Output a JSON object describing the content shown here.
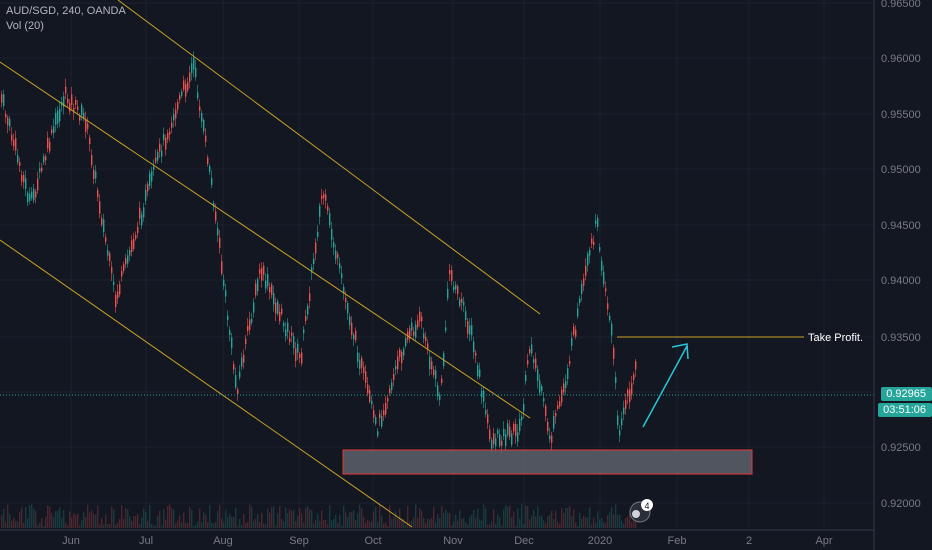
{
  "header": {
    "symbol": "AUD/SGD, 240, OANDA",
    "volume": "Vol (20)"
  },
  "y_axis": {
    "ticks": [
      "0.96500",
      "0.96000",
      "0.95500",
      "0.95000",
      "0.94500",
      "0.94000",
      "0.93500",
      "0.93000",
      "0.92500",
      "0.92000"
    ]
  },
  "x_axis": {
    "ticks": [
      "Jun",
      "Jul",
      "Aug",
      "Sep",
      "Oct",
      "Nov",
      "Dec",
      "2020",
      "Feb",
      "2",
      "Apr"
    ]
  },
  "current": {
    "price": "0.92965",
    "countdown": "03:51:06"
  },
  "annotation": {
    "take_profit": "Take Profit."
  },
  "event_badge": {
    "count": "4"
  },
  "colors": {
    "up": "#26a69a",
    "down": "#ef5350",
    "channel": "#c9a227",
    "zone": "#5d606b",
    "zone_border": "#e53935",
    "arrow": "#26c6da"
  }
}
